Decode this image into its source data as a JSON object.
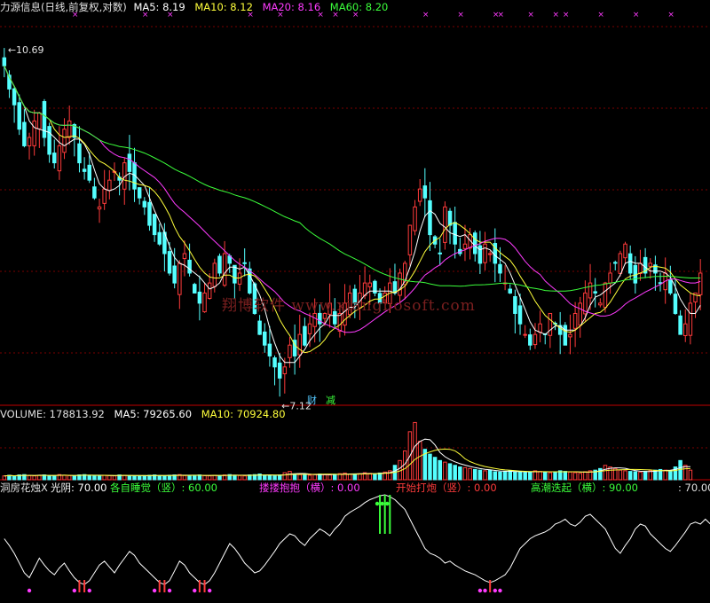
{
  "price_header": {
    "title": "力源信息(日线,前复权,对数)",
    "ma5": "MA5: 8.19",
    "ma10": "MA10: 8.12",
    "ma20": "MA20: 8.16",
    "ma60": "MA60: 8.20"
  },
  "volume_header": {
    "volume": "VOLUME: 178813.92",
    "ma5": "MA5: 79265.60",
    "ma10": "MA10: 70924.80"
  },
  "indicator_header": {
    "name": "洞房花烛X",
    "guangyin": "光阴: 70.00",
    "gezi": "各自睡觉（竖）: 60.00",
    "loulou": "搂搂抱抱（横）: 0.00",
    "kaishi": "开始打炮（竖）: 0.00",
    "gaochao": "高潮迭起（横）: 90.00",
    "right_value": ": 70.00"
  },
  "annotations": {
    "high_label": "10.69",
    "low_label": "7.12",
    "badge_cai": "财",
    "badge_jian": "减"
  },
  "watermark": "翔博软件  www.xiangbosoft.com",
  "colors": {
    "up": "#ff3b3b",
    "down": "#54ffff",
    "ma5": "#ffffff",
    "ma10": "#ffff3b",
    "ma20": "#ff3bff",
    "ma60": "#3bff3b",
    "grid": "#7a0000",
    "gezi": "#3bff3b",
    "loulou": "#ff3bff",
    "kaishi": "#ff3b3b",
    "gaochao": "#3bff3b"
  },
  "chart_data": {
    "type": "candlestick",
    "price_range": [
      7.0,
      11.3
    ],
    "closes": [
      10.6,
      10.3,
      10.1,
      9.8,
      9.6,
      9.7,
      9.9,
      10.0,
      9.7,
      9.5,
      9.4,
      9.6,
      9.8,
      9.9,
      9.7,
      9.4,
      9.3,
      9.2,
      9.0,
      8.9,
      9.1,
      9.2,
      9.3,
      9.2,
      9.4,
      9.3,
      9.1,
      9.0,
      8.9,
      8.7,
      8.6,
      8.5,
      8.4,
      8.2,
      8.1,
      8.3,
      8.4,
      8.2,
      8.0,
      7.9,
      8.0,
      8.1,
      8.3,
      8.2,
      8.4,
      8.3,
      8.1,
      8.2,
      8.3,
      8.0,
      7.8,
      7.6,
      7.5,
      7.4,
      7.3,
      7.2,
      7.3,
      7.5,
      7.4,
      7.6,
      7.5,
      7.7,
      7.8,
      7.7,
      7.8,
      7.9,
      7.7,
      7.8,
      7.9,
      8.0,
      7.9,
      8.0,
      8.1,
      8.1,
      8.0,
      7.9,
      8.0,
      8.1,
      8.0,
      8.2,
      8.3,
      8.7,
      8.9,
      9.1,
      9.0,
      8.6,
      8.5,
      8.4,
      8.9,
      8.7,
      8.5,
      8.4,
      8.5,
      8.6,
      8.4,
      8.3,
      8.5,
      8.4,
      8.3,
      8.2,
      8.1,
      8.0,
      7.8,
      7.7,
      7.6,
      7.5,
      7.6,
      7.7,
      7.6,
      7.8,
      7.7,
      7.6,
      7.5,
      7.6,
      7.8,
      7.9,
      8.0,
      8.1,
      8.0,
      7.9,
      8.1,
      8.2,
      8.3,
      8.4,
      8.5,
      8.2,
      8.1,
      8.3,
      8.2,
      8.3,
      8.2,
      8.1,
      8.2,
      8.0,
      7.8,
      7.6,
      7.7,
      7.9,
      8.0,
      8.2
    ],
    "volume_range": [
      0,
      180000
    ],
    "volumes": [
      12000,
      14000,
      11000,
      15000,
      16000,
      13000,
      12000,
      14000,
      15000,
      13000,
      12000,
      16000,
      14000,
      13000,
      12000,
      15000,
      16000,
      14000,
      13000,
      12000,
      14000,
      13000,
      12000,
      15000,
      14000,
      13000,
      12000,
      11000,
      13000,
      14000,
      15000,
      13000,
      12000,
      14000,
      15000,
      16000,
      13000,
      12000,
      14000,
      15000,
      13000,
      12000,
      14000,
      13000,
      15000,
      16000,
      14000,
      13000,
      12000,
      15000,
      16000,
      18000,
      14000,
      13000,
      12000,
      15000,
      22000,
      26000,
      18000,
      16000,
      15000,
      14000,
      17000,
      18000,
      16000,
      15000,
      17000,
      19000,
      21000,
      18000,
      17000,
      19000,
      22000,
      20000,
      18000,
      21000,
      24000,
      28000,
      45000,
      60000,
      90000,
      150000,
      178813,
      120000,
      95000,
      80000,
      70000,
      60000,
      55000,
      50000,
      45000,
      40000,
      38000,
      35000,
      32000,
      30000,
      28000,
      30000,
      25000,
      24000,
      26000,
      28000,
      25000,
      24000,
      22000,
      25000,
      28000,
      26000,
      24000,
      22000,
      25000,
      28000,
      26000,
      24000,
      22000,
      20000,
      25000,
      28000,
      30000,
      35000,
      45000,
      40000,
      35000,
      30000,
      28000,
      26000,
      25000,
      24000,
      26000,
      28000,
      30000,
      32000,
      30000,
      28000,
      40000,
      60000,
      45000,
      30000
    ],
    "indicator_range": [
      0,
      100
    ],
    "indicator": [
      55,
      48,
      40,
      30,
      20,
      15,
      25,
      35,
      28,
      22,
      18,
      25,
      30,
      22,
      15,
      10,
      8,
      12,
      20,
      28,
      32,
      26,
      20,
      28,
      35,
      42,
      38,
      30,
      25,
      20,
      15,
      10,
      8,
      12,
      22,
      32,
      28,
      20,
      15,
      10,
      8,
      12,
      20,
      30,
      40,
      50,
      45,
      38,
      30,
      25,
      20,
      22,
      28,
      35,
      42,
      50,
      55,
      60,
      58,
      52,
      48,
      55,
      60,
      65,
      62,
      58,
      65,
      70,
      78,
      82,
      85,
      88,
      92,
      95,
      97,
      99,
      100,
      98,
      95,
      90,
      85,
      75,
      65,
      55,
      45,
      40,
      38,
      35,
      30,
      32,
      28,
      25,
      22,
      20,
      18,
      15,
      12,
      10,
      12,
      15,
      18,
      25,
      35,
      45,
      50,
      55,
      58,
      60,
      62,
      65,
      70,
      72,
      75,
      70,
      68,
      72,
      78,
      80,
      75,
      70,
      65,
      55,
      45,
      40,
      48,
      55,
      65,
      70,
      68,
      60,
      55,
      50,
      45,
      42,
      48,
      55,
      62,
      70,
      72,
      70,
      75,
      70
    ]
  }
}
